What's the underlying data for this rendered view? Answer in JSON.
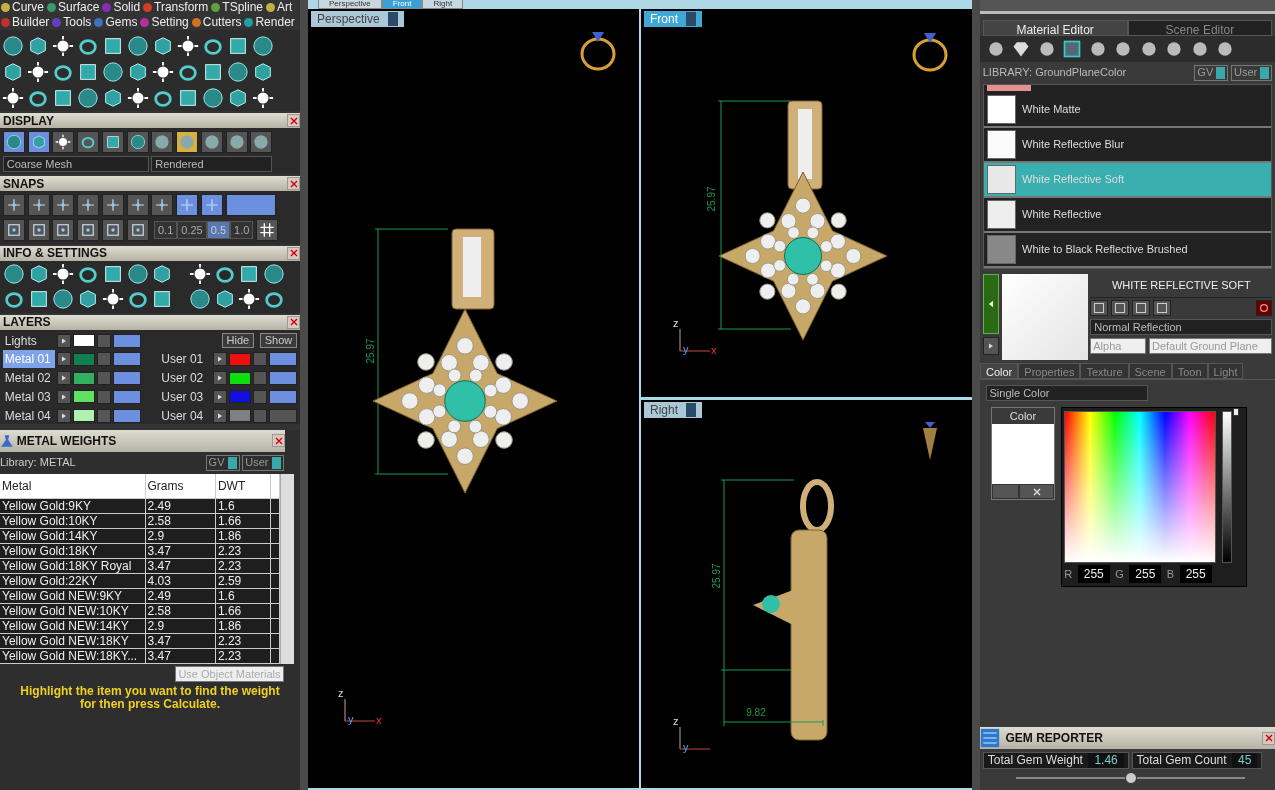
{
  "menu_rows": [
    [
      {
        "label": "Curve",
        "color": "#c8b040"
      },
      {
        "label": "Surface",
        "color": "#3a9a6a"
      },
      {
        "label": "Solid",
        "color": "#8030b0"
      },
      {
        "label": "Transform",
        "color": "#d04020"
      },
      {
        "label": "TSpline",
        "color": "#60a040"
      },
      {
        "label": "Art",
        "color": "#c0b040"
      }
    ],
    [
      {
        "label": "Builder",
        "color": "#c03030"
      },
      {
        "label": "Tools",
        "color": "#6040c0"
      },
      {
        "label": "Gems",
        "color": "#4070c0"
      },
      {
        "label": "Setting",
        "color": "#b030a0"
      },
      {
        "label": "Cutters",
        "color": "#d07020"
      },
      {
        "label": "Render",
        "color": "#20a0a0"
      }
    ]
  ],
  "display": {
    "title": "DISPLAY",
    "view_modes": [
      {
        "on": true
      },
      {
        "on": true
      },
      {
        "on": false
      },
      {
        "on": false
      },
      {
        "on": false
      },
      {
        "on": false
      }
    ],
    "shading": [
      {
        "selected": false
      },
      {
        "selected": true
      },
      {
        "selected": false
      },
      {
        "selected": false
      },
      {
        "selected": false
      }
    ],
    "mesh": "Coarse Mesh",
    "render": "Rendered"
  },
  "snaps": {
    "title": "SNAPS",
    "icons": [
      {
        "on": false
      },
      {
        "on": false
      },
      {
        "on": false
      },
      {
        "on": false
      },
      {
        "on": false
      },
      {
        "on": false
      },
      {
        "on": false
      },
      {
        "on": true
      },
      {
        "on": true
      }
    ],
    "steps": [
      {
        "label": "0.1",
        "selected": false
      },
      {
        "label": "0.25",
        "selected": false
      },
      {
        "label": "0.5",
        "selected": true
      },
      {
        "label": "1.0",
        "selected": false
      }
    ]
  },
  "info": {
    "title": "INFO & SETTINGS"
  },
  "layers": {
    "title": "LAYERS",
    "lights": {
      "label": "Lights",
      "color": "#ffffff",
      "visible": true
    },
    "hide": "Hide",
    "show": "Show",
    "metal": [
      {
        "label": "Metal 01",
        "color": "#108050",
        "selected": true,
        "visible": true
      },
      {
        "label": "Metal 02",
        "color": "#30b060",
        "selected": false,
        "visible": true
      },
      {
        "label": "Metal 03",
        "color": "#60e060",
        "selected": false,
        "visible": true
      },
      {
        "label": "Metal 04",
        "color": "#b0f0b0",
        "selected": false,
        "visible": true
      }
    ],
    "user": [
      {
        "label": "User 01",
        "color": "#ee1010",
        "selected": false,
        "visible": true
      },
      {
        "label": "User 02",
        "color": "#10dd10",
        "selected": false,
        "visible": true
      },
      {
        "label": "User 03",
        "color": "#1010dd",
        "selected": false,
        "visible": true
      },
      {
        "label": "User 04",
        "color": "#808080",
        "selected": false,
        "visible": false
      }
    ]
  },
  "metal_weights": {
    "title": "METAL WEIGHTS",
    "library": "Library: METAL",
    "gv": "GV",
    "user": "User",
    "columns": [
      "Metal",
      "Grams",
      "DWT"
    ],
    "rows": [
      [
        "Yellow Gold:9KY",
        "2.49",
        "1.6"
      ],
      [
        "Yellow Gold:10KY",
        "2.58",
        "1.66"
      ],
      [
        "Yellow Gold:14KY",
        "2.9",
        "1.86"
      ],
      [
        "Yellow Gold:18KY",
        "3.47",
        "2.23"
      ],
      [
        "Yellow Gold:18KY Royal",
        "3.47",
        "2.23"
      ],
      [
        "Yellow Gold:22KY",
        "4.03",
        "2.59"
      ],
      [
        "Yellow Gold NEW:9KY",
        "2.49",
        "1.6"
      ],
      [
        "Yellow Gold NEW:10KY",
        "2.58",
        "1.66"
      ],
      [
        "Yellow Gold NEW:14KY",
        "2.9",
        "1.86"
      ],
      [
        "Yellow Gold NEW:18KY",
        "3.47",
        "2.23"
      ],
      [
        "Yellow Gold NEW:18KY...",
        "3.47",
        "2.23"
      ]
    ],
    "use_object_materials": "Use Object Materials",
    "hint": "Highlight the item you want to find the weight for then press Calculate."
  },
  "view_tabs": [
    {
      "label": "Perspective",
      "selected": false
    },
    {
      "label": "Front",
      "selected": true
    },
    {
      "label": "Right",
      "selected": false
    }
  ],
  "viewports": [
    {
      "kind": "perspective",
      "label": "Perspective",
      "dimension": "25.97",
      "axes": [
        "z",
        "y",
        "x"
      ]
    },
    {
      "kind": "front",
      "label": "Front",
      "dimension": "25.97",
      "axes": [
        "z",
        "y",
        "x"
      ]
    },
    {
      "kind": "side",
      "label": "Right",
      "dimension": "25.97",
      "width_dimension": "9.82",
      "axes": [
        "z",
        "y"
      ]
    }
  ],
  "editor_tabs": [
    {
      "label": "Material Editor",
      "selected": true
    },
    {
      "label": "Scene Editor",
      "selected": false
    }
  ],
  "library": {
    "label": "LIBRARY: GroundPlaneColor",
    "gv": "GV",
    "user": "User"
  },
  "materials": [
    {
      "label": "White Matte",
      "color": "#ffffff",
      "selected": false
    },
    {
      "label": "White Reflective Blur",
      "color": "#fbfbfb",
      "selected": false
    },
    {
      "label": "White Reflective Soft",
      "color": "#e8e8e8",
      "selected": true
    },
    {
      "label": "White Reflective",
      "color": "#eeeeee",
      "selected": false
    },
    {
      "label": "White to Black Reflective Brushed",
      "color": "#888888",
      "selected": false
    }
  ],
  "material": {
    "title": "WHITE REFLECTIVE SOFT",
    "reflection": "Normal Reflection",
    "alpha": "Alpha",
    "ground": "Default Ground Plane"
  },
  "property_tabs": [
    {
      "label": "Color",
      "selected": true
    },
    {
      "label": "Properties",
      "selected": false
    },
    {
      "label": "Texture",
      "selected": false
    },
    {
      "label": "Scene",
      "selected": false
    },
    {
      "label": "Toon",
      "selected": false
    },
    {
      "label": "Light",
      "selected": false
    }
  ],
  "color_panel": {
    "mode": "Single Color",
    "swatch_label": "Color",
    "color": "#ffffff",
    "r": "255",
    "g": "255",
    "b": "255",
    "r_label": "R",
    "g_label": "G",
    "b_label": "B",
    "level": 1
  },
  "gem_reporter": {
    "title": "GEM REPORTER",
    "weight_label": "Total Gem Weight",
    "weight": "1.46",
    "count_label": "Total Gem Count",
    "count": "45",
    "level": 0.5
  }
}
